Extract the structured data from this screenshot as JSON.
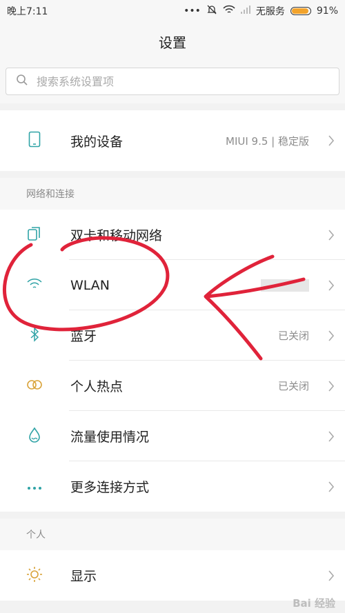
{
  "status_bar": {
    "time": "晚上7:11",
    "carrier": "无服务",
    "battery": "91%",
    "battery_level": 0.91
  },
  "header": {
    "title": "设置"
  },
  "search": {
    "placeholder": "搜索系统设置项"
  },
  "my_device": {
    "label": "我的设备",
    "value": "MIUI 9.5 | 稳定版",
    "icon": "phone-icon"
  },
  "network": {
    "section_title": "网络和连接",
    "items": [
      {
        "label": "双卡和移动网络",
        "value": "",
        "icon": "dual-sim-icon"
      },
      {
        "label": "WLAN",
        "value": "",
        "icon": "wifi-icon"
      },
      {
        "label": "蓝牙",
        "value": "已关闭",
        "icon": "bluetooth-icon"
      },
      {
        "label": "个人热点",
        "value": "已关闭",
        "icon": "hotspot-icon"
      },
      {
        "label": "流量使用情况",
        "value": "",
        "icon": "data-usage-icon"
      },
      {
        "label": "更多连接方式",
        "value": "",
        "icon": "more-dots-icon"
      }
    ]
  },
  "personal": {
    "section_title": "个人",
    "items": [
      {
        "label": "显示",
        "value": "",
        "icon": "brightness-icon"
      }
    ]
  },
  "colors": {
    "accent": "#2fa3a6",
    "annotation": "#e0233a",
    "battery": "#f2a32c"
  },
  "watermark": "Bai 经验"
}
